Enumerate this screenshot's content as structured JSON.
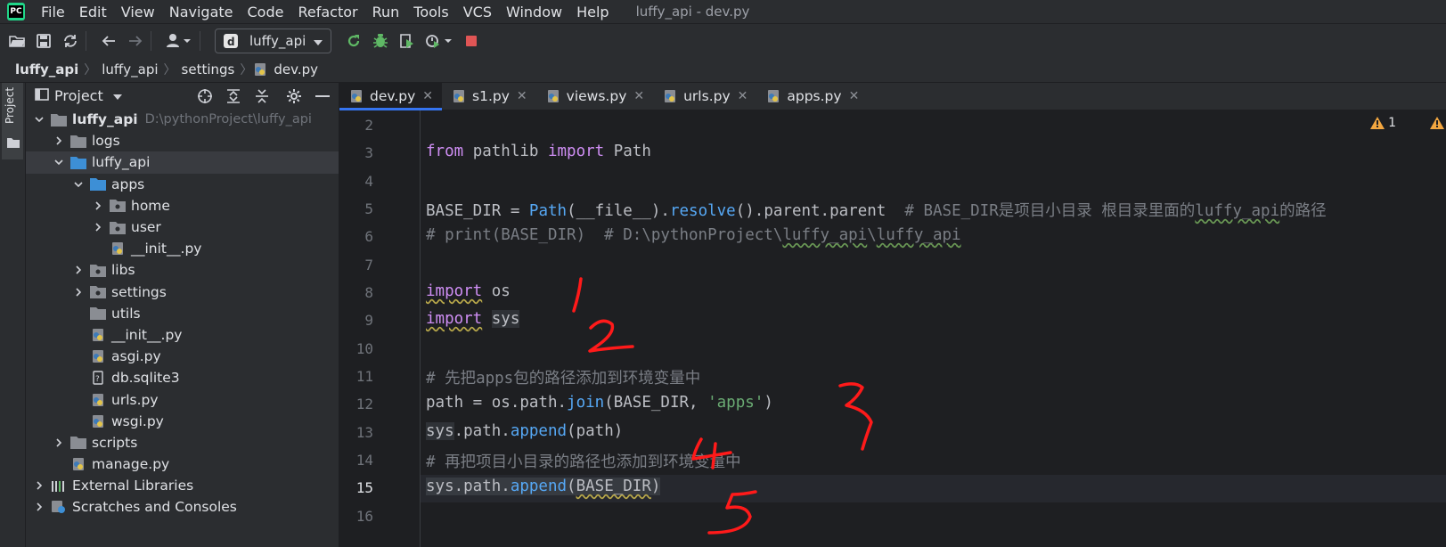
{
  "menu": {
    "items": [
      "File",
      "Edit",
      "View",
      "Navigate",
      "Code",
      "Refactor",
      "Run",
      "Tools",
      "VCS",
      "Window",
      "Help"
    ],
    "window_title": "luffy_api - dev.py"
  },
  "toolbar": {
    "run_config": "luffy_api"
  },
  "breadcrumb": [
    "luffy_api",
    "luffy_api",
    "settings",
    "dev.py"
  ],
  "sidebar": {
    "strip_label": "Project",
    "panel_title": "Project"
  },
  "tree": {
    "root_name": "luffy_api",
    "root_path": "D:\\pythonProject\\luffy_api",
    "items": [
      "logs",
      "luffy_api",
      "apps",
      "home",
      "user",
      "__init__.py",
      "libs",
      "settings",
      "utils",
      "__init__.py",
      "asgi.py",
      "db.sqlite3",
      "urls.py",
      "wsgi.py",
      "scripts",
      "manage.py",
      "External Libraries",
      "Scratches and Consoles"
    ]
  },
  "tabs": [
    "dev.py",
    "s1.py",
    "views.py",
    "urls.py",
    "apps.py"
  ],
  "editor": {
    "warning_count": "1",
    "line_numbers": [
      "2",
      "3",
      "4",
      "5",
      "6",
      "7",
      "8",
      "9",
      "10",
      "11",
      "12",
      "13",
      "14",
      "15",
      "16"
    ],
    "tokens": {
      "from": "from",
      "pathlib": " pathlib ",
      "import": "import",
      "Path": " Path",
      "base_dir_assign": "BASE_DIR = ",
      "PathCall": "Path",
      "file_part": "(__file__).",
      "resolve": "resolve",
      "parent_part": "().parent.parent  ",
      "c5a": "# BASE_DIR是项目小目录 根目录里面的",
      "c5b": "luffy_api",
      "c5c": "的路径",
      "c6a": "# print(BASE_DIR)  # D:\\pythonProject\\",
      "c6b": "luffy_api",
      "c6c": "\\",
      "c6d": "luffy_api",
      "import_os": "import",
      "os": " os",
      "import_sys": "import",
      "sys": "sys",
      "c11": "# 先把apps包的路径添加到环境变量中",
      "path_assign": "path = os.path.",
      "join": "join",
      "join_args": "(BASE_DIR, ",
      "apps_str": "'apps'",
      "close_paren": ")",
      "sys13": "sys",
      "path13": ".path.",
      "append13": "append",
      "args13": "(path)",
      "c14": "# 再把项目小目录的路径也添加到环境变量中",
      "sys15": "sys.path.",
      "append15": "append",
      "args15a": "(",
      "args15b": "BASE_DIR",
      "args15c": ")"
    }
  },
  "colors": {
    "accent": "#3574f0",
    "keyword": "#cf8ef4",
    "function": "#56a8f5",
    "string": "#6aab73",
    "comment": "#7a7e85",
    "annotation": "#ff1a1a"
  },
  "annotations": [
    "1",
    "2",
    "3",
    "4",
    "5"
  ]
}
